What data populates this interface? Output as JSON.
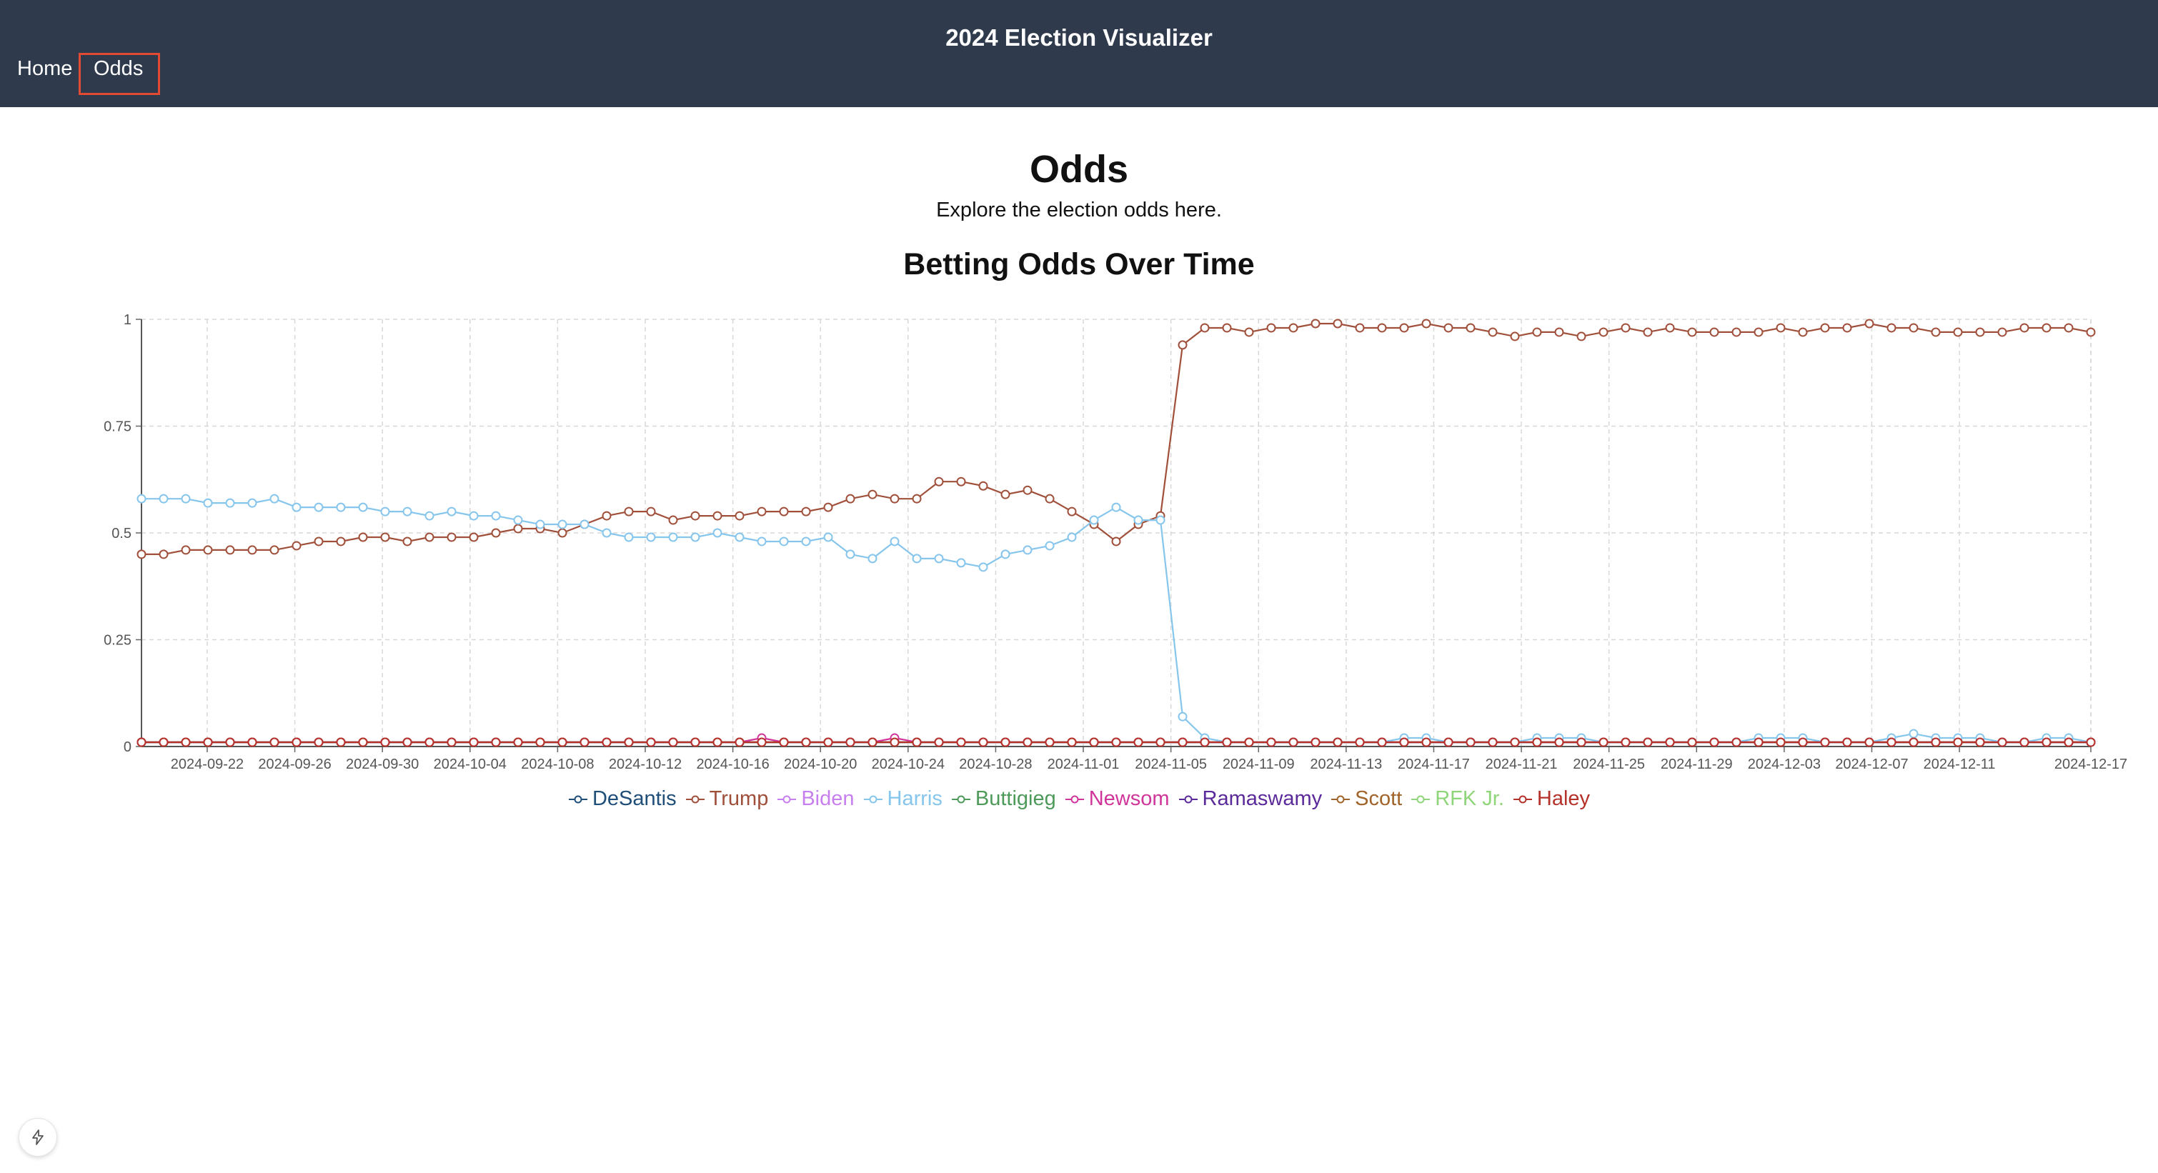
{
  "app": {
    "title": "2024 Election Visualizer"
  },
  "nav": {
    "home": "Home",
    "odds": "Odds"
  },
  "page": {
    "title": "Odds",
    "subtitle": "Explore the election odds here."
  },
  "chart_data": {
    "type": "line",
    "title": "Betting Odds Over Time",
    "xlabel": "",
    "ylabel": "",
    "ylim": [
      0,
      1
    ],
    "yticks": [
      "0",
      "0.25",
      "0.5",
      "0.75",
      "1"
    ],
    "grid": true,
    "legend_position": "bottom",
    "x_tick_labels": [
      "2024-09-22",
      "2024-09-26",
      "2024-09-30",
      "2024-10-04",
      "2024-10-08",
      "2024-10-12",
      "2024-10-16",
      "2024-10-20",
      "2024-10-24",
      "2024-10-28",
      "2024-11-01",
      "2024-11-05",
      "2024-11-09",
      "2024-11-13",
      "2024-11-17",
      "2024-11-21",
      "2024-11-25",
      "2024-11-29",
      "2024-12-03",
      "2024-12-07",
      "2024-12-11",
      "2024-12-17"
    ],
    "x_start": "2024-09-19",
    "x_end": "2024-12-17",
    "series": [
      {
        "name": "DeSantis",
        "color": "#1f4e79",
        "values": "zeros"
      },
      {
        "name": "Trump",
        "color": "#a0503a",
        "values": [
          0.45,
          0.45,
          0.46,
          0.46,
          0.46,
          0.46,
          0.46,
          0.47,
          0.48,
          0.48,
          0.49,
          0.49,
          0.48,
          0.49,
          0.49,
          0.49,
          0.5,
          0.51,
          0.51,
          0.5,
          0.52,
          0.54,
          0.55,
          0.55,
          0.53,
          0.54,
          0.54,
          0.54,
          0.55,
          0.55,
          0.55,
          0.56,
          0.58,
          0.59,
          0.58,
          0.58,
          0.62,
          0.62,
          0.61,
          0.59,
          0.6,
          0.58,
          0.55,
          0.52,
          0.48,
          0.52,
          0.54,
          0.94,
          0.98,
          0.98,
          0.97,
          0.98,
          0.98,
          0.99,
          0.99,
          0.98,
          0.98,
          0.98,
          0.99,
          0.98,
          0.98,
          0.97,
          0.96,
          0.97,
          0.97,
          0.96,
          0.97,
          0.98,
          0.97,
          0.98,
          0.97,
          0.97,
          0.97,
          0.97,
          0.98,
          0.97,
          0.98,
          0.98,
          0.99,
          0.98,
          0.98,
          0.97,
          0.97,
          0.97,
          0.97,
          0.98,
          0.98,
          0.98,
          0.97
        ]
      },
      {
        "name": "Biden",
        "color": "#c77ff0",
        "values": "zeros"
      },
      {
        "name": "Harris",
        "color": "#86c5ec",
        "values": [
          0.58,
          0.58,
          0.58,
          0.57,
          0.57,
          0.57,
          0.58,
          0.56,
          0.56,
          0.56,
          0.56,
          0.55,
          0.55,
          0.54,
          0.55,
          0.54,
          0.54,
          0.53,
          0.52,
          0.52,
          0.52,
          0.5,
          0.49,
          0.49,
          0.49,
          0.49,
          0.5,
          0.49,
          0.48,
          0.48,
          0.48,
          0.49,
          0.45,
          0.44,
          0.48,
          0.44,
          0.44,
          0.43,
          0.42,
          0.45,
          0.46,
          0.47,
          0.49,
          0.53,
          0.56,
          0.53,
          0.53,
          0.07,
          0.02,
          0.01,
          0.01,
          0.01,
          0.01,
          0.01,
          0.01,
          0.01,
          0.01,
          0.02,
          0.02,
          0.01,
          0.01,
          0.01,
          0.01,
          0.02,
          0.02,
          0.02,
          0.01,
          0.01,
          0.01,
          0.01,
          0.01,
          0.01,
          0.01,
          0.02,
          0.02,
          0.02,
          0.01,
          0.01,
          0.01,
          0.02,
          0.03,
          0.02,
          0.02,
          0.02,
          0.01,
          0.01,
          0.02,
          0.02,
          0.01
        ]
      },
      {
        "name": "Buttigieg",
        "color": "#4e9a5a",
        "values": "zeros"
      },
      {
        "name": "Newsom",
        "color": "#d0359a",
        "values": [
          0.01,
          0.01,
          0.01,
          0.01,
          0.01,
          0.01,
          0.01,
          0.01,
          0.01,
          0.01,
          0.01,
          0.01,
          0.01,
          0.01,
          0.01,
          0.01,
          0.01,
          0.01,
          0.01,
          0.01,
          0.01,
          0.01,
          0.01,
          0.01,
          0.01,
          0.01,
          0.01,
          0.01,
          0.02,
          0.01,
          0.01,
          0.01,
          0.01,
          0.01,
          0.02,
          0.01,
          0.01,
          0.01,
          0.01,
          0.01,
          0.01,
          0.01,
          0.01,
          0.01,
          0.01,
          0.01,
          0.01,
          0.01,
          0.01,
          0.01,
          0.01,
          0.01,
          0.01,
          0.01,
          0.01,
          0.01,
          0.01,
          0.01,
          0.01,
          0.01,
          0.01,
          0.01,
          0.01,
          0.01,
          0.01,
          0.01,
          0.01,
          0.01,
          0.01,
          0.01,
          0.01,
          0.01,
          0.01,
          0.01,
          0.01,
          0.01,
          0.01,
          0.01,
          0.01,
          0.01,
          0.01,
          0.01,
          0.01,
          0.01,
          0.01,
          0.01,
          0.01,
          0.01,
          0.01
        ]
      },
      {
        "name": "Ramaswamy",
        "color": "#5b2a9a",
        "values": "zeros"
      },
      {
        "name": "Scott",
        "color": "#a0642a",
        "values": "zeros"
      },
      {
        "name": "RFK Jr.",
        "color": "#8fd67a",
        "values": "zeros"
      },
      {
        "name": "Haley",
        "color": "#b5322a",
        "values": [
          0.01,
          0.01,
          0.01,
          0.01,
          0.01,
          0.01,
          0.01,
          0.01,
          0.01,
          0.01,
          0.01,
          0.01,
          0.01,
          0.01,
          0.01,
          0.01,
          0.01,
          0.01,
          0.01,
          0.01,
          0.01,
          0.01,
          0.01,
          0.01,
          0.01,
          0.01,
          0.01,
          0.01,
          0.01,
          0.01,
          0.01,
          0.01,
          0.01,
          0.01,
          0.01,
          0.01,
          0.01,
          0.01,
          0.01,
          0.01,
          0.01,
          0.01,
          0.01,
          0.01,
          0.01,
          0.01,
          0.01,
          0.01,
          0.01,
          0.01,
          0.01,
          0.01,
          0.01,
          0.01,
          0.01,
          0.01,
          0.01,
          0.01,
          0.01,
          0.01,
          0.01,
          0.01,
          0.01,
          0.01,
          0.01,
          0.01,
          0.01,
          0.01,
          0.01,
          0.01,
          0.01,
          0.01,
          0.01,
          0.01,
          0.01,
          0.01,
          0.01,
          0.01,
          0.01,
          0.01,
          0.01,
          0.01,
          0.01,
          0.01,
          0.01,
          0.01,
          0.01,
          0.01,
          0.01
        ]
      }
    ]
  }
}
